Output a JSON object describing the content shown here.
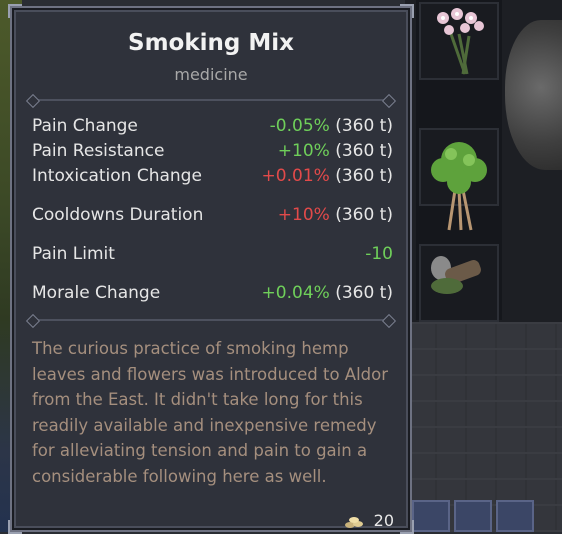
{
  "tooltip": {
    "title": "Smoking Mix",
    "category": "medicine",
    "stats": [
      {
        "name": "Pain Change",
        "value": "-0.05%",
        "duration": "(360 t)",
        "tone": "good"
      },
      {
        "name": "Pain Resistance",
        "value": "+10%",
        "duration": "(360 t)",
        "tone": "good"
      },
      {
        "name": "Intoxication Change",
        "value": "+0.01%",
        "duration": "(360 t)",
        "tone": "bad"
      },
      {
        "name": "Cooldowns Duration",
        "value": "+10%",
        "duration": "(360 t)",
        "tone": "bad"
      },
      {
        "name": "Pain Limit",
        "value": "-10",
        "duration": "",
        "tone": "good"
      },
      {
        "name": "Morale Change",
        "value": "+0.04%",
        "duration": "(360 t)",
        "tone": "good"
      }
    ],
    "description": "The curious practice of smoking hemp leaves and flowers was introduced to Aldor from the East. It didn't take long for this readily available and inexpensive remedy for alleviating tension and pain to gain a considerable following here as well.",
    "price": "20",
    "price_icon": "gold-coins-icon"
  },
  "colors": {
    "good": "#6fcf5a",
    "bad": "#e24a4a",
    "description": "#a58f7e"
  },
  "inventory": {
    "items": [
      "flowers-bundle-icon",
      "herb-bundle-icon",
      "smoking-mix-icon"
    ]
  }
}
